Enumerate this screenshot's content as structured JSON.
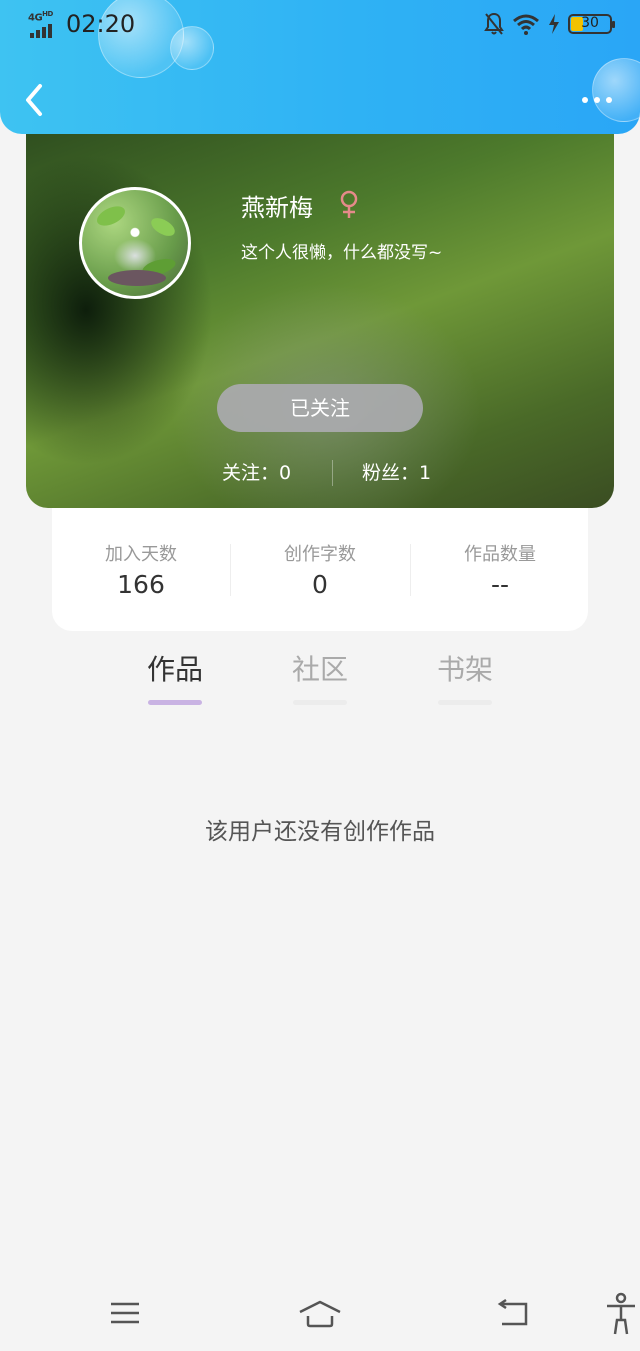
{
  "status_bar": {
    "network": "4G",
    "network_hd": "HD",
    "time": "02:20",
    "battery": "30",
    "icons": [
      "signal-icon",
      "bell-off-icon",
      "wifi-icon",
      "charging-icon",
      "battery-icon"
    ]
  },
  "nav": {
    "back_icon": "back-chevron-icon",
    "more_icon": "more-dots-icon"
  },
  "profile": {
    "name": "燕新梅",
    "gender_icon": "female-icon",
    "bio": "这个人很懒，什么都没写~",
    "follow_button": "已关注",
    "following": "关注：0",
    "fans": "粉丝：1"
  },
  "stats": [
    {
      "label": "加入天数",
      "value": "166"
    },
    {
      "label": "创作字数",
      "value": "0"
    },
    {
      "label": "作品数量",
      "value": "--"
    }
  ],
  "tabs": [
    {
      "label": "作品",
      "active": true
    },
    {
      "label": "社区",
      "active": false
    },
    {
      "label": "书架",
      "active": false
    }
  ],
  "empty_message": "该用户还没有创作作品",
  "bottom_nav": [
    "menu-icon",
    "home-icon",
    "back-icon",
    "accessibility-icon"
  ],
  "colors": {
    "header_gradient_start": "#3ec3f2",
    "header_gradient_end": "#2aa6f6",
    "active_tab_underline": "#c9b3e3",
    "gender_icon": "#e58a8a",
    "follow_button_bg": "#aaaaaf"
  }
}
